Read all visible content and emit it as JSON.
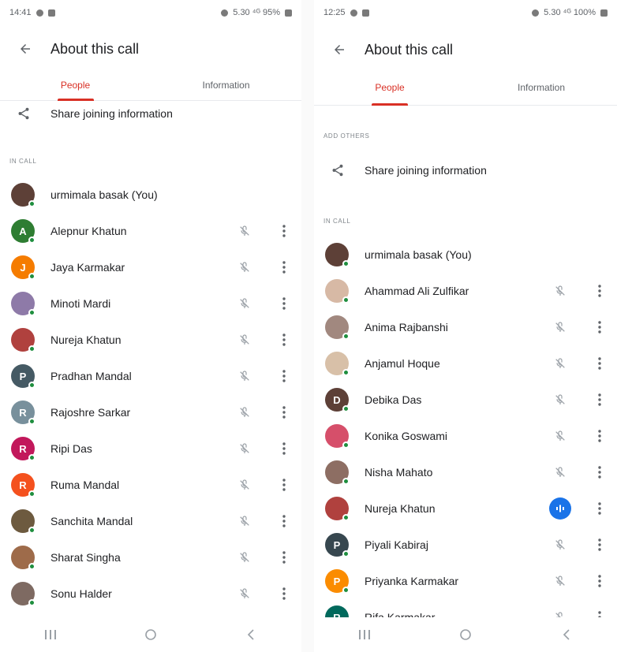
{
  "left": {
    "status_time": "14:41",
    "status_right": "5.30 ⁴ᴳ 95%",
    "title": "About this call",
    "tabs": [
      {
        "label": "People",
        "active": true
      },
      {
        "label": "Information",
        "active": false
      }
    ],
    "share_label": "Share joining information",
    "in_call_label": "IN CALL",
    "people": [
      {
        "name": "urmimala basak (You)",
        "initial": "",
        "color": "#5d4037",
        "self": true
      },
      {
        "name": "Alepnur Khatun",
        "initial": "A",
        "color": "#2e7d32"
      },
      {
        "name": "Jaya Karmakar",
        "initial": "J",
        "color": "#f57c00"
      },
      {
        "name": "Minoti Mardi",
        "initial": "",
        "color": "#8e7aa8"
      },
      {
        "name": "Nureja Khatun",
        "initial": "",
        "color": "#b0413e"
      },
      {
        "name": "Pradhan Mandal",
        "initial": "P",
        "color": "#455a64"
      },
      {
        "name": "Rajoshre Sarkar",
        "initial": "R",
        "color": "#78909c"
      },
      {
        "name": "Ripi Das",
        "initial": "R",
        "color": "#c2185b"
      },
      {
        "name": "Ruma Mandal",
        "initial": "R",
        "color": "#f4511e"
      },
      {
        "name": "Sanchita Mandal",
        "initial": "",
        "color": "#6d5a3f"
      },
      {
        "name": "Sharat Singha",
        "initial": "",
        "color": "#9e6b4a"
      },
      {
        "name": "Sonu Halder",
        "initial": "",
        "color": "#7e6a62"
      }
    ]
  },
  "right": {
    "status_time": "12:25",
    "status_right": "5.30 ⁴ᴳ 100%",
    "title": "About this call",
    "tabs": [
      {
        "label": "People",
        "active": true
      },
      {
        "label": "Information",
        "active": false
      }
    ],
    "add_others_label": "ADD OTHERS",
    "share_label": "Share joining information",
    "in_call_label": "IN CALL",
    "people": [
      {
        "name": "urmimala basak (You)",
        "initial": "",
        "color": "#5d4037",
        "self": true
      },
      {
        "name": "Ahammad Ali Zulfikar",
        "initial": "",
        "color": "#d7b9a5"
      },
      {
        "name": "Anima Rajbanshi",
        "initial": "",
        "color": "#a1887f"
      },
      {
        "name": "Anjamul Hoque",
        "initial": "",
        "color": "#d8c0a8"
      },
      {
        "name": "Debika Das",
        "initial": "D",
        "color": "#5d4037"
      },
      {
        "name": "Konika Goswami",
        "initial": "",
        "color": "#d64f6a"
      },
      {
        "name": "Nisha Mahato",
        "initial": "",
        "color": "#8d6e63"
      },
      {
        "name": "Nureja Khatun",
        "initial": "",
        "color": "#b0413e",
        "speaking": true
      },
      {
        "name": "Piyali Kabiraj",
        "initial": "P",
        "color": "#37474f"
      },
      {
        "name": "Priyanka Karmakar",
        "initial": "P",
        "color": "#fb8c00"
      },
      {
        "name": "Rifa Karmakar",
        "initial": "R",
        "color": "#00695c"
      }
    ]
  },
  "icons": {
    "back": "arrow-back-icon",
    "share": "share-icon",
    "mic_off": "mic-off-icon",
    "speaking": "audio-wave-icon",
    "more": "more-vert-icon",
    "nav_recents": "recents-icon",
    "nav_home": "home-icon",
    "nav_back": "nav-back-icon"
  },
  "colors": {
    "accent_red": "#d93025",
    "presence_green": "#1e8e3e",
    "speaking_blue": "#1a73e8"
  }
}
